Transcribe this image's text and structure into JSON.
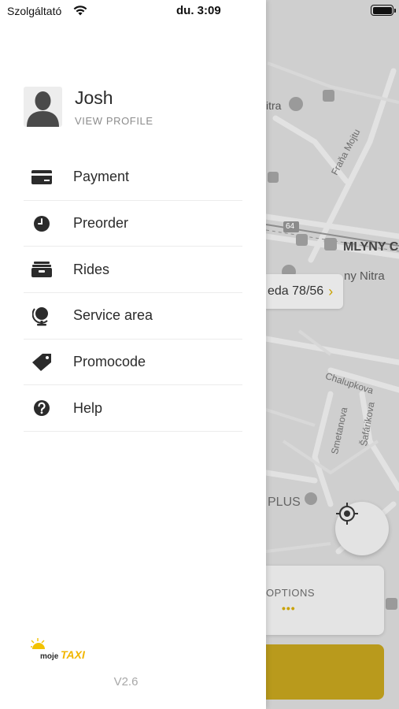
{
  "status_bar": {
    "carrier": "Szolgáltató",
    "time": "du. 3:09"
  },
  "drawer": {
    "user": {
      "name": "Josh",
      "view_profile": "VIEW PROFILE"
    },
    "menu": [
      {
        "label": "Payment",
        "icon": "credit-card-icon"
      },
      {
        "label": "Preorder",
        "icon": "clock-icon"
      },
      {
        "label": "Rides",
        "icon": "rides-icon"
      },
      {
        "label": "Service area",
        "icon": "globe-icon"
      },
      {
        "label": "Promocode",
        "icon": "tag-icon"
      },
      {
        "label": "Help",
        "icon": "help-icon"
      }
    ],
    "brand": {
      "prefix": "moje",
      "name": "TAXI"
    },
    "version": "V2.6"
  },
  "map": {
    "labels": {
      "itra": "itra",
      "frana_mojtu": "Fraňa Mojtu",
      "route_64": "64",
      "mlyny": "MLYNY C",
      "ny_nitra": "ny Nitra",
      "chalupkova": "Chalupkova",
      "smetanova": "Smetanova",
      "safarikova": "Šafárikova",
      "plus": "PLUS"
    },
    "address": "eda 78/56",
    "options_label": "OPTIONS",
    "options_dots": "•••"
  },
  "colors": {
    "accent": "#c9a200",
    "map_bg": "#cfcfcf",
    "drawer_bg": "#ffffff"
  }
}
